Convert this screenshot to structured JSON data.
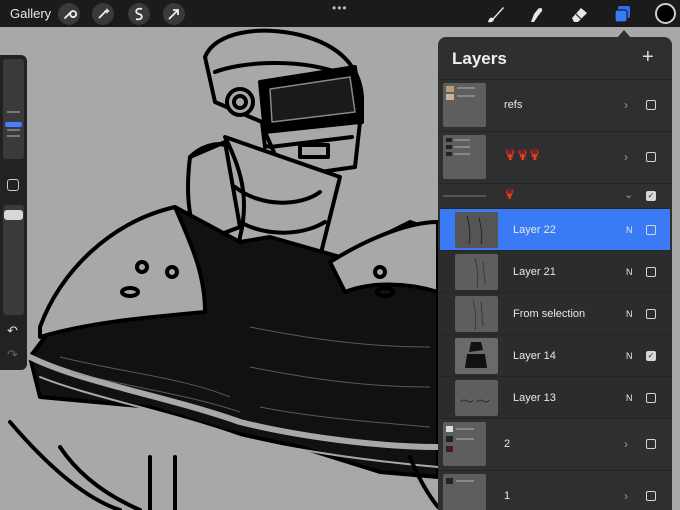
{
  "topbar": {
    "gallery_label": "Gallery",
    "left_tools": [
      "wrench-icon",
      "magic-wand-icon",
      "selection-icon",
      "transform-arrow-icon"
    ],
    "more_dots": "•••",
    "right_tools": [
      "brush-icon",
      "smudge-icon",
      "eraser-icon",
      "layers-icon"
    ],
    "current_color": "#000000"
  },
  "sidebar": {
    "undo_icon": "↶",
    "redo_icon": "↷"
  },
  "layers_panel": {
    "title": "Layers",
    "add_icon": "+",
    "layers": [
      {
        "name": "refs",
        "mode": "",
        "visible": false,
        "group": true,
        "expanded": false,
        "selected": false
      },
      {
        "name": "🦞🦞🦞",
        "mode": "",
        "visible": false,
        "group": true,
        "expanded": false,
        "selected": false
      },
      {
        "name": "🦞",
        "mode": "",
        "visible": true,
        "group": true,
        "expanded": true,
        "selected": false
      },
      {
        "name": "Layer 22",
        "mode": "N",
        "visible": false,
        "group": false,
        "selected": true
      },
      {
        "name": "Layer 21",
        "mode": "N",
        "visible": false,
        "group": false,
        "selected": false
      },
      {
        "name": "From selection",
        "mode": "N",
        "visible": false,
        "group": false,
        "selected": false
      },
      {
        "name": "Layer 14",
        "mode": "N",
        "visible": true,
        "group": false,
        "selected": false
      },
      {
        "name": "Layer 13",
        "mode": "N",
        "visible": false,
        "group": false,
        "selected": false
      },
      {
        "name": "2",
        "mode": "",
        "visible": false,
        "group": true,
        "expanded": false,
        "selected": false
      },
      {
        "name": "1",
        "mode": "",
        "visible": false,
        "group": true,
        "expanded": false,
        "selected": false
      }
    ]
  },
  "colors": {
    "accent": "#3a7bf5",
    "panel_bg": "#2f2f2f",
    "canvas_bg": "#a8a8a8"
  }
}
